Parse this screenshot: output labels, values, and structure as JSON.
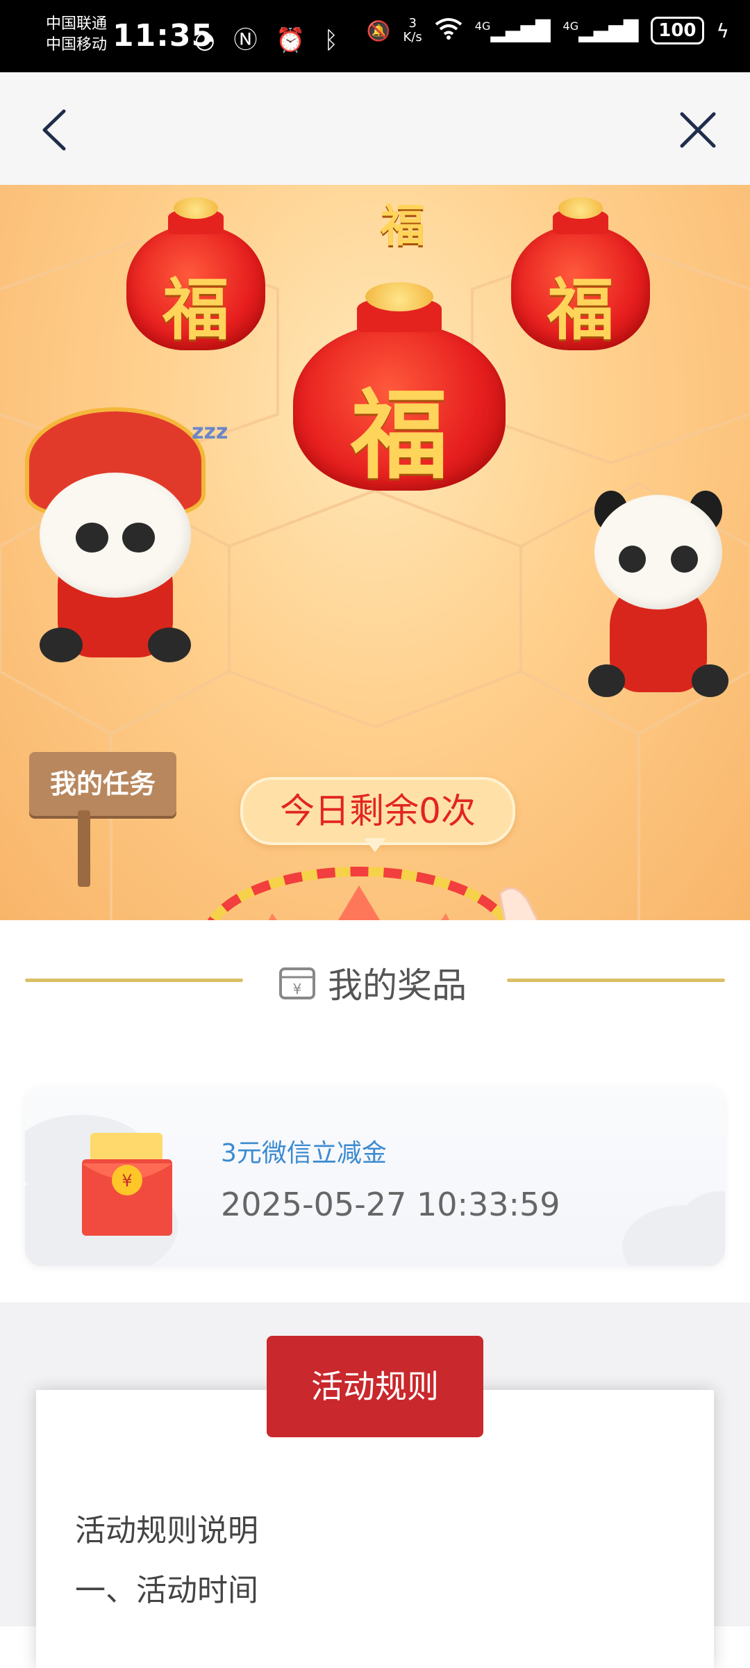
{
  "status_bar": {
    "carrier_1": "中国联通",
    "carrier_2": "中国移动",
    "time": "11:35",
    "net_speed_value": "3",
    "net_speed_unit": "K/s",
    "signal_1": "4G",
    "signal_2": "4G",
    "battery": "100"
  },
  "nav": {
    "back_icon": "chevron-left-icon",
    "close_icon": "close-icon"
  },
  "banner": {
    "bag_character": "福",
    "task_sign": "我的任务",
    "remaining": "今日剩余0次"
  },
  "prizes": {
    "title": "我的奖品",
    "items": [
      {
        "name": "3元微信立减金",
        "time": "2025-05-27 10:33:59"
      }
    ]
  },
  "rules": {
    "button_label": "活动规则",
    "heading": "活动规则说明",
    "section_1": "一、活动时间"
  },
  "colors": {
    "accent_red": "#c9282c",
    "gold_line": "#d9bf63",
    "prize_name": "#3b8ad1"
  }
}
